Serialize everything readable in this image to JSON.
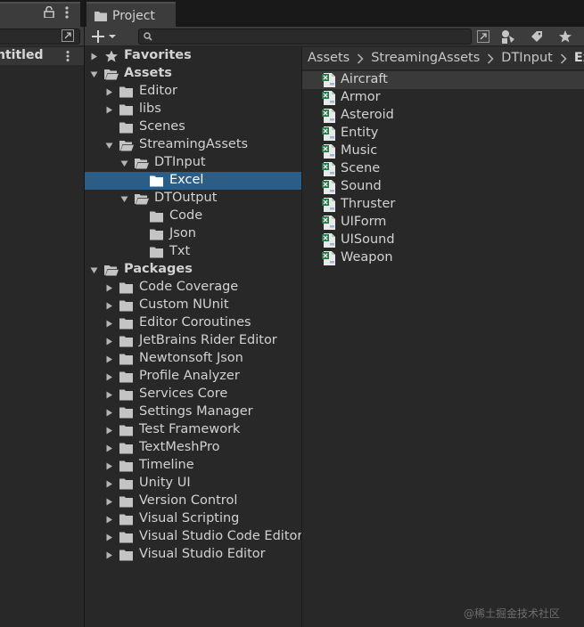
{
  "left_panel": {
    "tab_label": "y",
    "scene_label": "ntitled"
  },
  "project_panel": {
    "tab_label": "Project",
    "search": {
      "value": "",
      "placeholder": ""
    },
    "tree": [
      {
        "label": "Favorites",
        "depth": 0,
        "bold": true,
        "arrow": "collapsed",
        "icon": "star-icon"
      },
      {
        "label": "Assets",
        "depth": 0,
        "bold": true,
        "arrow": "expanded",
        "icon": "folder-open-icon"
      },
      {
        "label": "Editor",
        "depth": 1,
        "bold": false,
        "arrow": "collapsed",
        "icon": "folder-icon"
      },
      {
        "label": "libs",
        "depth": 1,
        "bold": false,
        "arrow": "collapsed",
        "icon": "folder-icon"
      },
      {
        "label": "Scenes",
        "depth": 1,
        "bold": false,
        "arrow": "none",
        "icon": "folder-icon"
      },
      {
        "label": "StreamingAssets",
        "depth": 1,
        "bold": false,
        "arrow": "expanded",
        "icon": "folder-open-icon"
      },
      {
        "label": "DTInput",
        "depth": 2,
        "bold": false,
        "arrow": "expanded",
        "icon": "folder-open-icon"
      },
      {
        "label": "Excel",
        "depth": 3,
        "bold": false,
        "arrow": "none",
        "icon": "folder-icon",
        "selected": true
      },
      {
        "label": "DTOutput",
        "depth": 2,
        "bold": false,
        "arrow": "expanded",
        "icon": "folder-open-icon"
      },
      {
        "label": "Code",
        "depth": 3,
        "bold": false,
        "arrow": "none",
        "icon": "folder-icon"
      },
      {
        "label": "Json",
        "depth": 3,
        "bold": false,
        "arrow": "none",
        "icon": "folder-icon"
      },
      {
        "label": "Txt",
        "depth": 3,
        "bold": false,
        "arrow": "none",
        "icon": "folder-icon"
      },
      {
        "label": "Packages",
        "depth": 0,
        "bold": true,
        "arrow": "expanded",
        "icon": "folder-open-icon"
      },
      {
        "label": "Code Coverage",
        "depth": 1,
        "bold": false,
        "arrow": "collapsed",
        "icon": "folder-icon"
      },
      {
        "label": "Custom NUnit",
        "depth": 1,
        "bold": false,
        "arrow": "collapsed",
        "icon": "folder-icon"
      },
      {
        "label": "Editor Coroutines",
        "depth": 1,
        "bold": false,
        "arrow": "collapsed",
        "icon": "folder-icon"
      },
      {
        "label": "JetBrains Rider Editor",
        "depth": 1,
        "bold": false,
        "arrow": "collapsed",
        "icon": "folder-icon"
      },
      {
        "label": "Newtonsoft Json",
        "depth": 1,
        "bold": false,
        "arrow": "collapsed",
        "icon": "folder-icon"
      },
      {
        "label": "Profile Analyzer",
        "depth": 1,
        "bold": false,
        "arrow": "collapsed",
        "icon": "folder-icon"
      },
      {
        "label": "Services Core",
        "depth": 1,
        "bold": false,
        "arrow": "collapsed",
        "icon": "folder-icon"
      },
      {
        "label": "Settings Manager",
        "depth": 1,
        "bold": false,
        "arrow": "collapsed",
        "icon": "folder-icon"
      },
      {
        "label": "Test Framework",
        "depth": 1,
        "bold": false,
        "arrow": "collapsed",
        "icon": "folder-icon"
      },
      {
        "label": "TextMeshPro",
        "depth": 1,
        "bold": false,
        "arrow": "collapsed",
        "icon": "folder-icon"
      },
      {
        "label": "Timeline",
        "depth": 1,
        "bold": false,
        "arrow": "collapsed",
        "icon": "folder-icon"
      },
      {
        "label": "Unity UI",
        "depth": 1,
        "bold": false,
        "arrow": "collapsed",
        "icon": "folder-icon"
      },
      {
        "label": "Version Control",
        "depth": 1,
        "bold": false,
        "arrow": "collapsed",
        "icon": "folder-icon"
      },
      {
        "label": "Visual Scripting",
        "depth": 1,
        "bold": false,
        "arrow": "collapsed",
        "icon": "folder-icon"
      },
      {
        "label": "Visual Studio Code Editor",
        "depth": 1,
        "bold": false,
        "arrow": "collapsed",
        "icon": "folder-icon"
      },
      {
        "label": "Visual Studio Editor",
        "depth": 1,
        "bold": false,
        "arrow": "collapsed",
        "icon": "folder-icon"
      }
    ],
    "breadcrumb": [
      "Assets",
      "StreamingAssets",
      "DTInput",
      "Ex"
    ],
    "files": [
      "Aircraft",
      "Armor",
      "Asteroid",
      "Entity",
      "Music",
      "Scene",
      "Sound",
      "Thruster",
      "UIForm",
      "UISound",
      "Weapon"
    ],
    "file_icon": "excel-file-icon"
  },
  "colors": {
    "selection": "#2c5d87",
    "panel_bg": "#282828",
    "toolbar_bg": "#3c3c3c",
    "text": "#d2d2d2"
  },
  "watermark": "@稀土掘金技术社区"
}
